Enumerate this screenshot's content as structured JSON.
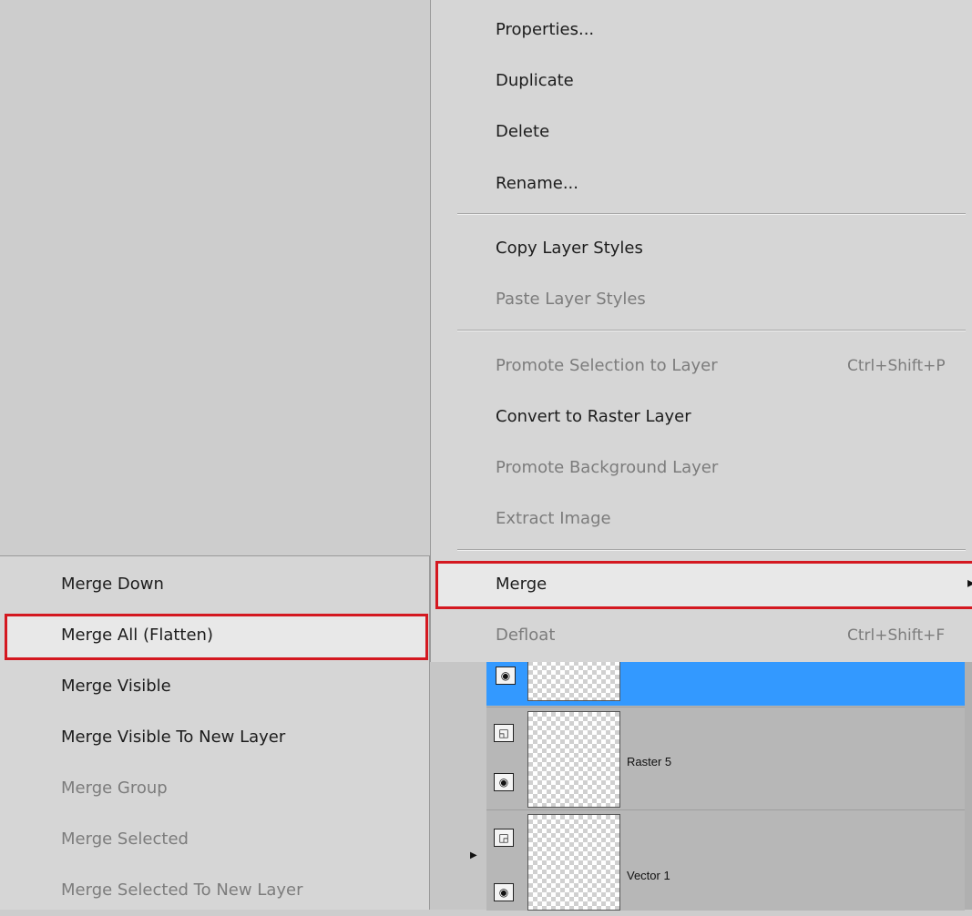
{
  "context_menu": {
    "items": [
      {
        "label": "Properties...",
        "enabled": true
      },
      {
        "label": "Duplicate",
        "enabled": true
      },
      {
        "label": "Delete",
        "enabled": true
      },
      {
        "label": "Rename...",
        "enabled": true
      },
      {
        "label": "Copy Layer Styles",
        "enabled": true
      },
      {
        "label": "Paste Layer Styles",
        "enabled": false
      },
      {
        "label": "Promote Selection to Layer",
        "enabled": false,
        "shortcut": "Ctrl+Shift+P"
      },
      {
        "label": "Convert to Raster Layer",
        "enabled": true
      },
      {
        "label": "Promote Background Layer",
        "enabled": false
      },
      {
        "label": "Extract Image",
        "enabled": false
      },
      {
        "label": "Merge",
        "enabled": true,
        "highlighted": true,
        "has_submenu": true
      },
      {
        "label": "Defloat",
        "enabled": false,
        "shortcut": "Ctrl+Shift+F"
      }
    ]
  },
  "merge_submenu": {
    "items": [
      {
        "label": "Merge Down",
        "enabled": true
      },
      {
        "label": "Merge All (Flatten)",
        "enabled": true,
        "highlighted": true
      },
      {
        "label": "Merge Visible",
        "enabled": true
      },
      {
        "label": "Merge Visible To New Layer",
        "enabled": true
      },
      {
        "label": "Merge Group",
        "enabled": false
      },
      {
        "label": "Merge Selected",
        "enabled": false
      },
      {
        "label": "Merge Selected To New Layer",
        "enabled": false
      }
    ]
  },
  "layers": [
    {
      "name": "",
      "selected": true
    },
    {
      "name": "Raster 5",
      "selected": false
    },
    {
      "name": "Vector 1",
      "selected": false
    }
  ],
  "colors": {
    "highlight_border": "#d41820",
    "selected_layer": "#3399ff",
    "menu_bg": "#d6d6d6",
    "disabled_text": "#7c7c7c"
  }
}
